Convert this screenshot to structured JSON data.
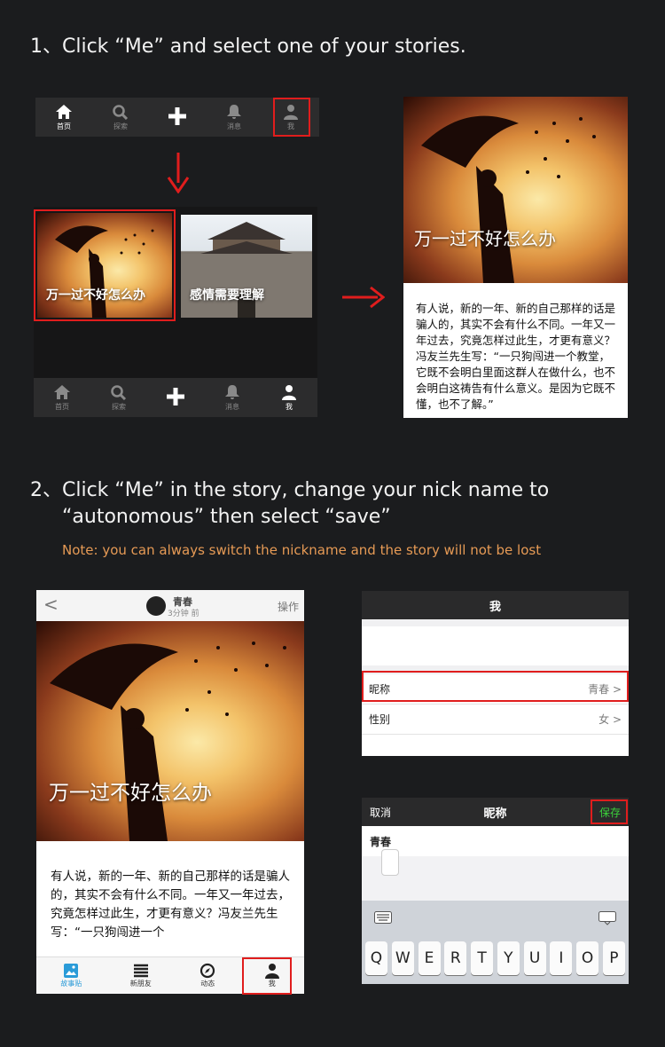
{
  "step1": {
    "text": "1、Click “Me” and select one of your stories."
  },
  "step2": {
    "line1": "2、Click “Me” in the story, change your nick name to",
    "line2": "“autonomous” then select “save”",
    "note": "Note: you can always switch the nickname and the story will not be lost"
  },
  "tabbar": {
    "items": [
      {
        "label": "首页",
        "icon": "home-icon"
      },
      {
        "label": "探索",
        "icon": "search-icon"
      },
      {
        "label": "",
        "icon": "plus-icon"
      },
      {
        "label": "消息",
        "icon": "bell-icon"
      },
      {
        "label": "我",
        "icon": "person-icon"
      }
    ]
  },
  "stories": [
    {
      "title": "万一过不好怎么办"
    },
    {
      "title": "感情需要理解"
    }
  ],
  "story_detail": {
    "title": "万一过不好怎么办",
    "text": "有人说，新的一年、新的自己那样的话是骗人的，其实不会有什么不同。一年又一年过去，究竟怎样过此生，才更有意义？冯友兰先生写：“一只狗闯进一个教堂，它既不会明白里面这群人在做什么，也不会明白这祷告有什么意义。是因为它既不懂，也不了解。”",
    "text_short": "有人说，新的一年、新的自己那样的话是骗人的，其实不会有什么不同。一年又一年过去，究竟怎样过此生，才更有意义？冯友兰先生写：“一只狗闯进一个"
  },
  "story_header": {
    "back": "<",
    "author": "青春",
    "time": "3分钟 前",
    "action": "操作"
  },
  "story_tabbar": {
    "items": [
      {
        "label": "故事贴",
        "icon": "image-icon"
      },
      {
        "label": "新朋友",
        "icon": "list-icon"
      },
      {
        "label": "动态",
        "icon": "compass-icon"
      },
      {
        "label": "我",
        "icon": "person-icon"
      }
    ]
  },
  "profile": {
    "title": "我",
    "rows": [
      {
        "label": "昵称",
        "value": "青春"
      },
      {
        "label": "性别",
        "value": "女"
      }
    ],
    "chevron": ">"
  },
  "nickname_edit": {
    "cancel": "取消",
    "title": "昵称",
    "save": "保存",
    "value": "青春"
  },
  "keyboard": {
    "keys": [
      "Q",
      "W",
      "E",
      "R",
      "T",
      "Y",
      "U",
      "I",
      "O",
      "P"
    ]
  },
  "colors": {
    "highlight": "#e01d1d",
    "save_green": "#3bd13b",
    "note": "#e69a55"
  }
}
